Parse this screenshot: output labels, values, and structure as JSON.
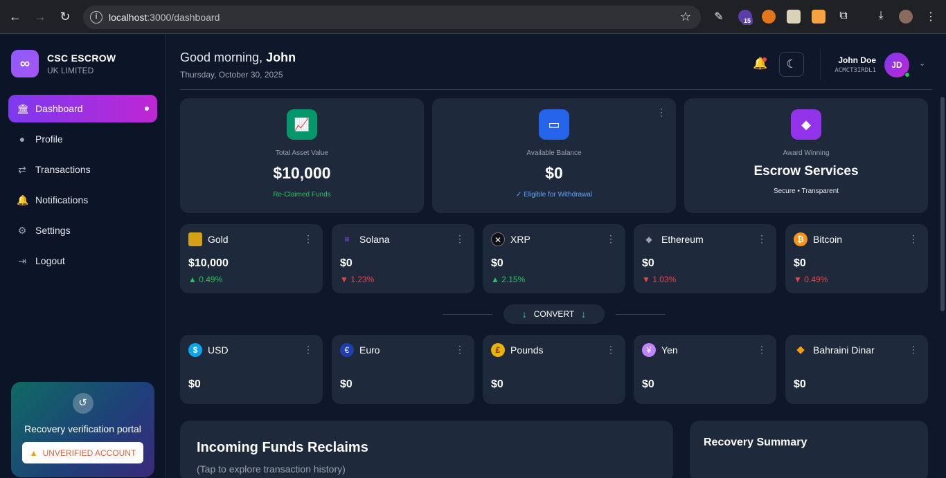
{
  "browser": {
    "url_host": "localhost",
    "url_path": ":3000/dashboard",
    "ext_badge": "15"
  },
  "brand": {
    "logo": "∞",
    "name": "CSC ESCROW",
    "sub": "UK LIMITED"
  },
  "menu": [
    {
      "label": "Dashboard",
      "icon": "bank-icon"
    },
    {
      "label": "Profile",
      "icon": "user-icon"
    },
    {
      "label": "Transactions",
      "icon": "transactions-icon"
    },
    {
      "label": "Notifications",
      "icon": "bell-icon"
    },
    {
      "label": "Settings",
      "icon": "gear-icon"
    },
    {
      "label": "Logout",
      "icon": "logout-icon"
    }
  ],
  "recovery": {
    "title": "Recovery verification portal",
    "button": "UNVERIFIED ACCOUNT"
  },
  "header": {
    "greeting": "Good morning,",
    "name": "John",
    "date": "Thursday, October 30, 2025"
  },
  "user": {
    "name": "John Doe",
    "id": "ACMCT3IRDL1",
    "initials": "JD"
  },
  "stats": [
    {
      "label": "Total Asset Value",
      "value": "$10,000",
      "sub": "Re-Claimed Funds",
      "color": "#22c55e"
    },
    {
      "label": "Available Balance",
      "value": "$0",
      "sub": "✓ Eligible for Withdrawal",
      "color": "#60a5fa"
    },
    {
      "label": "Award Winning",
      "value": "Escrow Services",
      "sub": "Secure • Transparent",
      "color": "#e5e7eb"
    }
  ],
  "assets": [
    {
      "name": "Gold",
      "value": "$10,000",
      "change": "▲ 0.49%",
      "dir": "up"
    },
    {
      "name": "Solana",
      "value": "$0",
      "change": "▼ 1.23%",
      "dir": "down"
    },
    {
      "name": "XRP",
      "value": "$0",
      "change": "▲ 2.15%",
      "dir": "up"
    },
    {
      "name": "Ethereum",
      "value": "$0",
      "change": "▼ 1.03%",
      "dir": "down"
    },
    {
      "name": "Bitcoin",
      "value": "$0",
      "change": "▼ 0.49%",
      "dir": "down"
    }
  ],
  "convert": {
    "label": "CONVERT"
  },
  "fiat": [
    {
      "name": "USD",
      "value": "$0",
      "symbol": "$"
    },
    {
      "name": "Euro",
      "value": "$0",
      "symbol": "€"
    },
    {
      "name": "Pounds",
      "value": "$0",
      "symbol": "£"
    },
    {
      "name": "Yen",
      "value": "$0",
      "symbol": "¥"
    },
    {
      "name": "Bahraini Dinar",
      "value": "$0",
      "symbol": "◆"
    }
  ],
  "reclaims": {
    "title": "Incoming Funds Reclaims",
    "sub": "(Tap to explore transaction history)"
  },
  "summary": {
    "title": "Recovery Summary"
  }
}
